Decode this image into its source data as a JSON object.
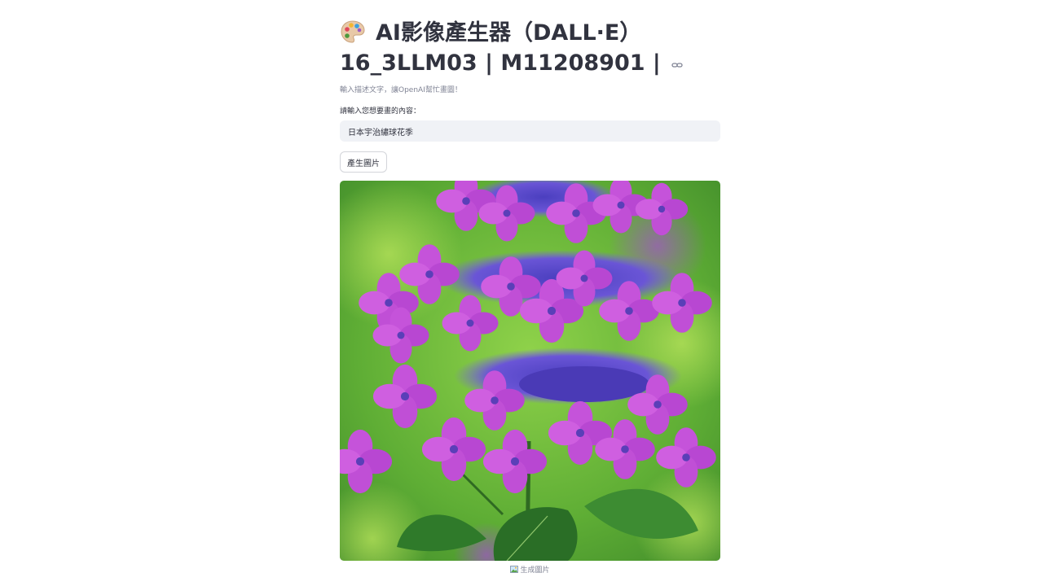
{
  "title": {
    "line1": "AI影像產生器（DALL·E）",
    "line2": "16_3LLM03 | M11208901 |",
    "icon": "palette-icon",
    "anchor_icon": "link-icon"
  },
  "caption": "輸入描述文字，讓OpenAI幫忙畫圖！",
  "prompt_input": {
    "label": "請輸入您想要畫的內容：",
    "value": "日本宇治繡球花季"
  },
  "generate_button": {
    "label": "產生圖片"
  },
  "generated_image": {
    "caption": "生成圖片",
    "caption_icon": "picture-icon",
    "subject": "purple hydrangea flowers",
    "colors": {
      "background": "#6fbf3a",
      "petal": "#c04fd6",
      "floret_center": "#6a4ac9",
      "leaf": "#2f7a2a"
    }
  },
  "colors": {
    "text": "#31333f",
    "muted": "#808495",
    "input_bg": "#f0f2f6",
    "border": "#d3d5da"
  }
}
